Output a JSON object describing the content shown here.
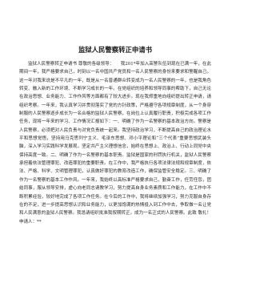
{
  "document": {
    "title": "监狱人民警察转正申请书",
    "paragraphs": [
      "监狱人民警察转正申请书 尊敬的各级领导：　　我201*年加入高警队伍到现在已满一年，在此期间一年，我严格要求自己，时刻以一名中国共产党员和一名人民警察的身份来要求和警醒自己。这一年对我来说是不平凡的一年，既是从一名普通群众转变成为一名人民警察的一年，也是我角色转变、融入新的工作环境、不断学习成长的一年。在党组织的培养和领导同事的帮助下，自己无论在政治思想、业务能力、工作作风等方面都有了较大进步。现在我郑重地向组织提出转正申请，请组织考察。一年来，我认真学习并贯彻落实了党的方针政策，严格遵守各项规章制度，从一个身穿制服的人民警察逐步成长为一名合格的监狱人民警察，在岗位上认真履行职责，积极完成各项工作任务，现将一年来的学习、工作情况汇报如下：一、明确了作为一名警察的基本政治方向。警察是人民警察，必须把对人民负责与对党负责统一起来。我坚持政治学习，不断提高自己的政治理论水平和思想觉悟，坚持用马克思列宁主义、毛泽东思想、邓小平理论和“三个代表”重要思想武装头脑，深入学习实践科学发展观，坚定共产主义理想信念，始终在思想上、政治上、行动上同党中央保持高度一致。二、明确了作为一名警察的基本职责。监狱是国家的刑罚执行机关，监狱人民警察承担着依法管理罪犯、改造罪犯的重要职责。在工作中，我严格执行各项法律法规和规章制度，依法、严格、科学、文明管理罪犯，认真做好罪犯的教育改造工作，确保监管安全稳定。三、明确了作为一名警察的基本工作作风。一年来，我始终以高标准严格要求自己，勤奋工作，任劳任怨，团结同事，服从领导安排，虚心向老同志请教学习，努力提高自身业务素质和工作能力，在工作中不断积累经验，较好地完成了各项工作任务。在今后的工作中，我将继续加强学习，努力克服自身存在的不足，进一步提高思想认识和业务能力，以更加饱满的热情投入到工作中去，争取做一名让党和人民满意的监狱人民警察。我恳请组织批准我按期转正，成为一名正式的人民警察。此致 敬礼！ 申请人：**"
    ]
  }
}
